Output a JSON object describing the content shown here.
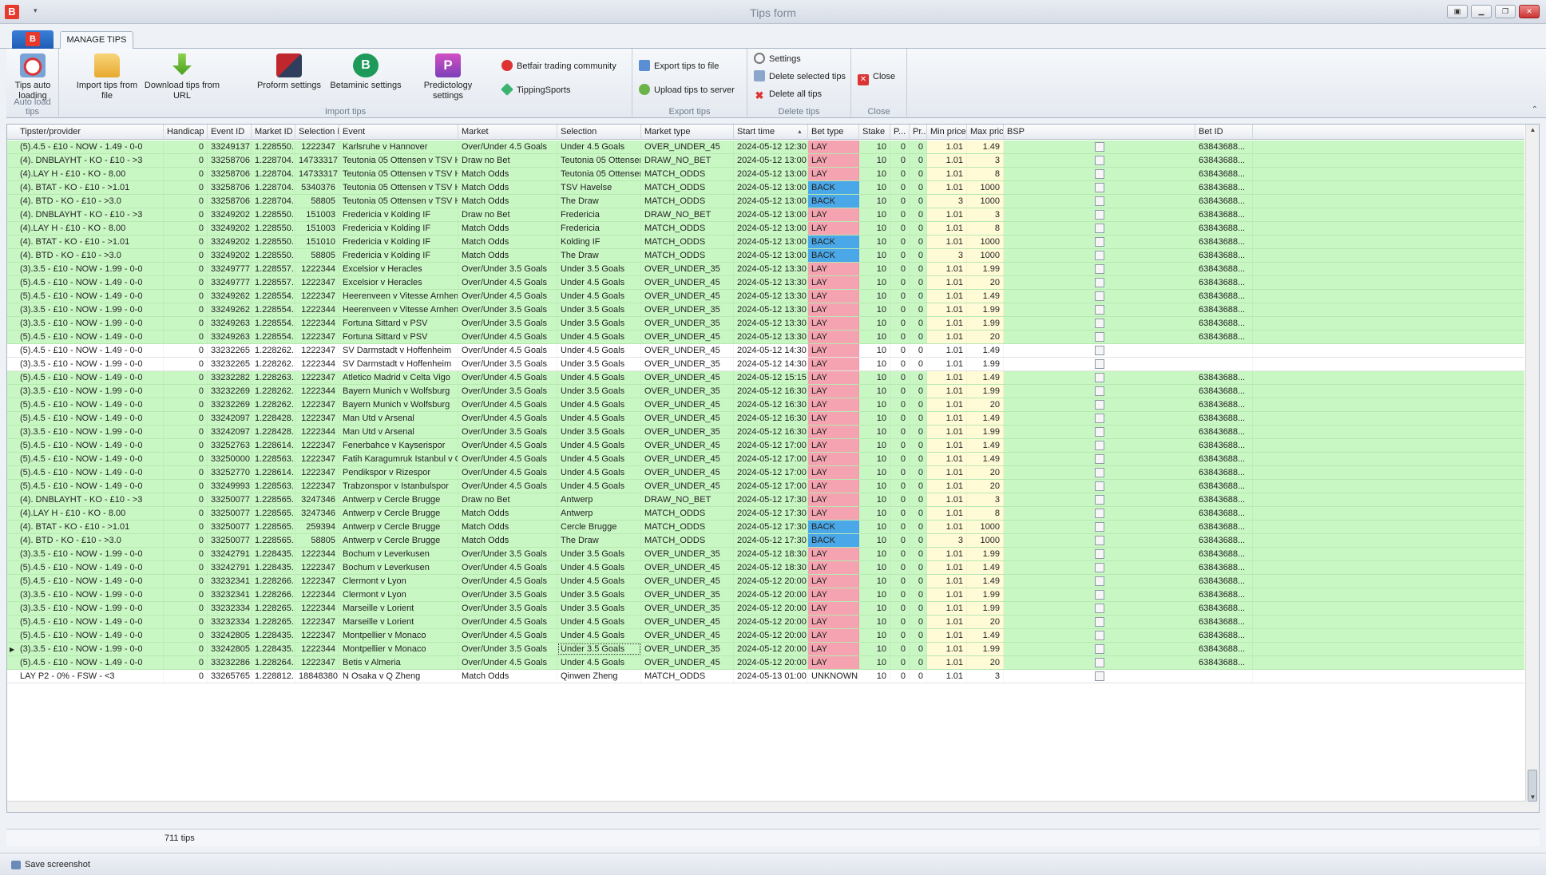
{
  "window": {
    "title": "Tips form",
    "logo": "B"
  },
  "ribbon": {
    "tab": "MANAGE TIPS",
    "groups": [
      {
        "title": "Auto load tips",
        "buttons": [
          {
            "label": "Tips auto loading",
            "icon": "auto-load-icon"
          }
        ]
      },
      {
        "title": "Import tips",
        "buttons": [
          {
            "label": "Import tips from file",
            "icon": "folder-icon"
          },
          {
            "label": "Download tips from URL",
            "icon": "download-icon"
          },
          {
            "label": "Proform settings",
            "icon": "proform-icon"
          },
          {
            "label": "Betaminic settings",
            "icon": "betaminic-icon"
          },
          {
            "label": "Predictology settings",
            "icon": "predictology-icon"
          },
          {
            "label": "Betfair trading community",
            "icon": "btc-icon"
          },
          {
            "label": "TippingSports",
            "icon": "tippingsports-icon"
          }
        ]
      },
      {
        "title": "Export tips",
        "buttons": [
          {
            "label": "Export tips to file",
            "icon": "export-icon"
          },
          {
            "label": "Upload tips to server",
            "icon": "upload-icon"
          }
        ]
      },
      {
        "title": "Delete tips",
        "buttons": [
          {
            "label": "Settings",
            "icon": "gear-icon"
          },
          {
            "label": "Delete selected tips",
            "icon": "delete-selected-icon"
          },
          {
            "label": "Delete all tips",
            "icon": "delete-all-icon"
          }
        ]
      },
      {
        "title": "Close",
        "buttons": [
          {
            "label": "Close",
            "icon": "close-icon"
          }
        ]
      }
    ]
  },
  "grid": {
    "columns": [
      "Tipster/provider",
      "Handicap",
      "Event ID",
      "Market ID",
      "Selection ID",
      "Event",
      "Market",
      "Selection",
      "Market type",
      "Start time",
      "Bet type",
      "Stake",
      "P...",
      "Pr...",
      "Min price",
      "Max price",
      "BSP",
      "Bet ID"
    ],
    "rows": [
      [
        "(5).4.5 - £10 - NOW - 1.49 - 0-0",
        "0",
        "33249137",
        "1.228550...",
        "1222347",
        "Karlsruhe v Hannover",
        "Over/Under 4.5 Goals",
        "Under 4.5 Goals",
        "OVER_UNDER_45",
        "2024-05-12 12:30",
        "LAY",
        "10",
        "0",
        "0",
        "1.01",
        "1.49",
        "",
        "63843688..."
      ],
      [
        "(4). DNBLAYHT - KO - £10 - >3",
        "0",
        "33258706",
        "1.228704...",
        "14733317",
        "Teutonia 05 Ottensen v TSV Havel...",
        "Draw no Bet",
        "Teutonia 05 Ottensen",
        "DRAW_NO_BET",
        "2024-05-12 13:00",
        "LAY",
        "10",
        "0",
        "0",
        "1.01",
        "3",
        "",
        "63843688..."
      ],
      [
        "(4).LAY H - £10 - KO - 8.00",
        "0",
        "33258706",
        "1.228704...",
        "14733317",
        "Teutonia 05 Ottensen v TSV Havel...",
        "Match Odds",
        "Teutonia 05 Ottensen",
        "MATCH_ODDS",
        "2024-05-12 13:00",
        "LAY",
        "10",
        "0",
        "0",
        "1.01",
        "8",
        "",
        "63843688..."
      ],
      [
        "(4). BTAT - KO - £10 - >1.01",
        "0",
        "33258706",
        "1.228704...",
        "5340376",
        "Teutonia 05 Ottensen v TSV Havel...",
        "Match Odds",
        "TSV Havelse",
        "MATCH_ODDS",
        "2024-05-12 13:00",
        "BACK",
        "10",
        "0",
        "0",
        "1.01",
        "1000",
        "",
        "63843688..."
      ],
      [
        "(4). BTD - KO - £10 - >3.0",
        "0",
        "33258706",
        "1.228704...",
        "58805",
        "Teutonia 05 Ottensen v TSV Havel...",
        "Match Odds",
        "The Draw",
        "MATCH_ODDS",
        "2024-05-12 13:00",
        "BACK",
        "10",
        "0",
        "0",
        "3",
        "1000",
        "",
        "63843688..."
      ],
      [
        "(4). DNBLAYHT - KO - £10 - >3",
        "0",
        "33249202",
        "1.228550...",
        "151003",
        "Fredericia v Kolding IF",
        "Draw no Bet",
        "Fredericia",
        "DRAW_NO_BET",
        "2024-05-12 13:00",
        "LAY",
        "10",
        "0",
        "0",
        "1.01",
        "3",
        "",
        "63843688..."
      ],
      [
        "(4).LAY H - £10 - KO - 8.00",
        "0",
        "33249202",
        "1.228550...",
        "151003",
        "Fredericia v Kolding IF",
        "Match Odds",
        "Fredericia",
        "MATCH_ODDS",
        "2024-05-12 13:00",
        "LAY",
        "10",
        "0",
        "0",
        "1.01",
        "8",
        "",
        "63843688..."
      ],
      [
        "(4). BTAT - KO - £10 - >1.01",
        "0",
        "33249202",
        "1.228550...",
        "151010",
        "Fredericia v Kolding IF",
        "Match Odds",
        "Kolding IF",
        "MATCH_ODDS",
        "2024-05-12 13:00",
        "BACK",
        "10",
        "0",
        "0",
        "1.01",
        "1000",
        "",
        "63843688..."
      ],
      [
        "(4). BTD - KO - £10 - >3.0",
        "0",
        "33249202",
        "1.228550...",
        "58805",
        "Fredericia v Kolding IF",
        "Match Odds",
        "The Draw",
        "MATCH_ODDS",
        "2024-05-12 13:00",
        "BACK",
        "10",
        "0",
        "0",
        "3",
        "1000",
        "",
        "63843688..."
      ],
      [
        "(3).3.5 - £10 - NOW - 1.99 - 0-0",
        "0",
        "33249777",
        "1.228557...",
        "1222344",
        "Excelsior v Heracles",
        "Over/Under 3.5 Goals",
        "Under 3.5 Goals",
        "OVER_UNDER_35",
        "2024-05-12 13:30",
        "LAY",
        "10",
        "0",
        "0",
        "1.01",
        "1.99",
        "",
        "63843688..."
      ],
      [
        "(5).4.5 - £10 - NOW - 1.49 - 0-0",
        "0",
        "33249777",
        "1.228557...",
        "1222347",
        "Excelsior v Heracles",
        "Over/Under 4.5 Goals",
        "Under 4.5 Goals",
        "OVER_UNDER_45",
        "2024-05-12 13:30",
        "LAY",
        "10",
        "0",
        "0",
        "1.01",
        "20",
        "",
        "63843688..."
      ],
      [
        "(5).4.5 - £10 - NOW - 1.49 - 0-0",
        "0",
        "33249262",
        "1.228554...",
        "1222347",
        "Heerenveen v Vitesse Arnhem",
        "Over/Under 4.5 Goals",
        "Under 4.5 Goals",
        "OVER_UNDER_45",
        "2024-05-12 13:30",
        "LAY",
        "10",
        "0",
        "0",
        "1.01",
        "1.49",
        "",
        "63843688..."
      ],
      [
        "(3).3.5 - £10 - NOW - 1.99 - 0-0",
        "0",
        "33249262",
        "1.228554...",
        "1222344",
        "Heerenveen v Vitesse Arnhem",
        "Over/Under 3.5 Goals",
        "Under 3.5 Goals",
        "OVER_UNDER_35",
        "2024-05-12 13:30",
        "LAY",
        "10",
        "0",
        "0",
        "1.01",
        "1.99",
        "",
        "63843688..."
      ],
      [
        "(3).3.5 - £10 - NOW - 1.99 - 0-0",
        "0",
        "33249263",
        "1.228554...",
        "1222344",
        "Fortuna Sittard v PSV",
        "Over/Under 3.5 Goals",
        "Under 3.5 Goals",
        "OVER_UNDER_35",
        "2024-05-12 13:30",
        "LAY",
        "10",
        "0",
        "0",
        "1.01",
        "1.99",
        "",
        "63843688..."
      ],
      [
        "(5).4.5 - £10 - NOW - 1.49 - 0-0",
        "0",
        "33249263",
        "1.228554...",
        "1222347",
        "Fortuna Sittard v PSV",
        "Over/Under 4.5 Goals",
        "Under 4.5 Goals",
        "OVER_UNDER_45",
        "2024-05-12 13:30",
        "LAY",
        "10",
        "0",
        "0",
        "1.01",
        "20",
        "",
        "63843688..."
      ],
      [
        "(5).4.5 - £10 - NOW - 1.49 - 0-0",
        "0",
        "33232265",
        "1.228262...",
        "1222347",
        "SV Darmstadt v Hoffenheim",
        "Over/Under 4.5 Goals",
        "Under 4.5 Goals",
        "OVER_UNDER_45",
        "2024-05-12 14:30",
        "LAY",
        "10",
        "0",
        "0",
        "1.01",
        "1.49",
        "",
        ""
      ],
      [
        "(3).3.5 - £10 - NOW - 1.99 - 0-0",
        "0",
        "33232265",
        "1.228262...",
        "1222344",
        "SV Darmstadt v Hoffenheim",
        "Over/Under 3.5 Goals",
        "Under 3.5 Goals",
        "OVER_UNDER_35",
        "2024-05-12 14:30",
        "LAY",
        "10",
        "0",
        "0",
        "1.01",
        "1.99",
        "",
        ""
      ],
      [
        "(5).4.5 - £10 - NOW - 1.49 - 0-0",
        "0",
        "33232282",
        "1.228263...",
        "1222347",
        "Atletico Madrid v Celta Vigo",
        "Over/Under 4.5 Goals",
        "Under 4.5 Goals",
        "OVER_UNDER_45",
        "2024-05-12 15:15",
        "LAY",
        "10",
        "0",
        "0",
        "1.01",
        "1.49",
        "",
        "63843688..."
      ],
      [
        "(3).3.5 - £10 - NOW - 1.99 - 0-0",
        "0",
        "33232269",
        "1.228262...",
        "1222344",
        "Bayern Munich v Wolfsburg",
        "Over/Under 3.5 Goals",
        "Under 3.5 Goals",
        "OVER_UNDER_35",
        "2024-05-12 16:30",
        "LAY",
        "10",
        "0",
        "0",
        "1.01",
        "1.99",
        "",
        "63843688..."
      ],
      [
        "(5).4.5 - £10 - NOW - 1.49 - 0-0",
        "0",
        "33232269",
        "1.228262...",
        "1222347",
        "Bayern Munich v Wolfsburg",
        "Over/Under 4.5 Goals",
        "Under 4.5 Goals",
        "OVER_UNDER_45",
        "2024-05-12 16:30",
        "LAY",
        "10",
        "0",
        "0",
        "1.01",
        "20",
        "",
        "63843688..."
      ],
      [
        "(5).4.5 - £10 - NOW - 1.49 - 0-0",
        "0",
        "33242097",
        "1.228428...",
        "1222347",
        "Man Utd v Arsenal",
        "Over/Under 4.5 Goals",
        "Under 4.5 Goals",
        "OVER_UNDER_45",
        "2024-05-12 16:30",
        "LAY",
        "10",
        "0",
        "0",
        "1.01",
        "1.49",
        "",
        "63843688..."
      ],
      [
        "(3).3.5 - £10 - NOW - 1.99 - 0-0",
        "0",
        "33242097",
        "1.228428...",
        "1222344",
        "Man Utd v Arsenal",
        "Over/Under 3.5 Goals",
        "Under 3.5 Goals",
        "OVER_UNDER_35",
        "2024-05-12 16:30",
        "LAY",
        "10",
        "0",
        "0",
        "1.01",
        "1.99",
        "",
        "63843688..."
      ],
      [
        "(5).4.5 - £10 - NOW - 1.49 - 0-0",
        "0",
        "33252763",
        "1.228614...",
        "1222347",
        "Fenerbahce v Kayserispor",
        "Over/Under 4.5 Goals",
        "Under 4.5 Goals",
        "OVER_UNDER_45",
        "2024-05-12 17:00",
        "LAY",
        "10",
        "0",
        "0",
        "1.01",
        "1.49",
        "",
        "63843688..."
      ],
      [
        "(5).4.5 - £10 - NOW - 1.49 - 0-0",
        "0",
        "33250000",
        "1.228563...",
        "1222347",
        "Fatih Karagumruk Istanbul v Galat...",
        "Over/Under 4.5 Goals",
        "Under 4.5 Goals",
        "OVER_UNDER_45",
        "2024-05-12 17:00",
        "LAY",
        "10",
        "0",
        "0",
        "1.01",
        "1.49",
        "",
        "63843688..."
      ],
      [
        "(5).4.5 - £10 - NOW - 1.49 - 0-0",
        "0",
        "33252770",
        "1.228614...",
        "1222347",
        "Pendikspor v Rizespor",
        "Over/Under 4.5 Goals",
        "Under 4.5 Goals",
        "OVER_UNDER_45",
        "2024-05-12 17:00",
        "LAY",
        "10",
        "0",
        "0",
        "1.01",
        "20",
        "",
        "63843688..."
      ],
      [
        "(5).4.5 - £10 - NOW - 1.49 - 0-0",
        "0",
        "33249993",
        "1.228563...",
        "1222347",
        "Trabzonspor v Istanbulspor",
        "Over/Under 4.5 Goals",
        "Under 4.5 Goals",
        "OVER_UNDER_45",
        "2024-05-12 17:00",
        "LAY",
        "10",
        "0",
        "0",
        "1.01",
        "20",
        "",
        "63843688..."
      ],
      [
        "(4). DNBLAYHT - KO - £10 - >3",
        "0",
        "33250077",
        "1.228565...",
        "3247346",
        "Antwerp v Cercle Brugge",
        "Draw no Bet",
        "Antwerp",
        "DRAW_NO_BET",
        "2024-05-12 17:30",
        "LAY",
        "10",
        "0",
        "0",
        "1.01",
        "3",
        "",
        "63843688..."
      ],
      [
        "(4).LAY H - £10 - KO - 8.00",
        "0",
        "33250077",
        "1.228565...",
        "3247346",
        "Antwerp v Cercle Brugge",
        "Match Odds",
        "Antwerp",
        "MATCH_ODDS",
        "2024-05-12 17:30",
        "LAY",
        "10",
        "0",
        "0",
        "1.01",
        "8",
        "",
        "63843688..."
      ],
      [
        "(4). BTAT - KO - £10 - >1.01",
        "0",
        "33250077",
        "1.228565...",
        "259394",
        "Antwerp v Cercle Brugge",
        "Match Odds",
        "Cercle Brugge",
        "MATCH_ODDS",
        "2024-05-12 17:30",
        "BACK",
        "10",
        "0",
        "0",
        "1.01",
        "1000",
        "",
        "63843688..."
      ],
      [
        "(4). BTD - KO - £10 - >3.0",
        "0",
        "33250077",
        "1.228565...",
        "58805",
        "Antwerp v Cercle Brugge",
        "Match Odds",
        "The Draw",
        "MATCH_ODDS",
        "2024-05-12 17:30",
        "BACK",
        "10",
        "0",
        "0",
        "3",
        "1000",
        "",
        "63843688..."
      ],
      [
        "(3).3.5 - £10 - NOW - 1.99 - 0-0",
        "0",
        "33242791",
        "1.228435...",
        "1222344",
        "Bochum v Leverkusen",
        "Over/Under 3.5 Goals",
        "Under 3.5 Goals",
        "OVER_UNDER_35",
        "2024-05-12 18:30",
        "LAY",
        "10",
        "0",
        "0",
        "1.01",
        "1.99",
        "",
        "63843688..."
      ],
      [
        "(5).4.5 - £10 - NOW - 1.49 - 0-0",
        "0",
        "33242791",
        "1.228435...",
        "1222347",
        "Bochum v Leverkusen",
        "Over/Under 4.5 Goals",
        "Under 4.5 Goals",
        "OVER_UNDER_45",
        "2024-05-12 18:30",
        "LAY",
        "10",
        "0",
        "0",
        "1.01",
        "1.49",
        "",
        "63843688..."
      ],
      [
        "(5).4.5 - £10 - NOW - 1.49 - 0-0",
        "0",
        "33232341",
        "1.228266...",
        "1222347",
        "Clermont v Lyon",
        "Over/Under 4.5 Goals",
        "Under 4.5 Goals",
        "OVER_UNDER_45",
        "2024-05-12 20:00",
        "LAY",
        "10",
        "0",
        "0",
        "1.01",
        "1.49",
        "",
        "63843688..."
      ],
      [
        "(3).3.5 - £10 - NOW - 1.99 - 0-0",
        "0",
        "33232341",
        "1.228266...",
        "1222344",
        "Clermont v Lyon",
        "Over/Under 3.5 Goals",
        "Under 3.5 Goals",
        "OVER_UNDER_35",
        "2024-05-12 20:00",
        "LAY",
        "10",
        "0",
        "0",
        "1.01",
        "1.99",
        "",
        "63843688..."
      ],
      [
        "(3).3.5 - £10 - NOW - 1.99 - 0-0",
        "0",
        "33232334",
        "1.228265...",
        "1222344",
        "Marseille v Lorient",
        "Over/Under 3.5 Goals",
        "Under 3.5 Goals",
        "OVER_UNDER_35",
        "2024-05-12 20:00",
        "LAY",
        "10",
        "0",
        "0",
        "1.01",
        "1.99",
        "",
        "63843688..."
      ],
      [
        "(5).4.5 - £10 - NOW - 1.49 - 0-0",
        "0",
        "33232334",
        "1.228265...",
        "1222347",
        "Marseille v Lorient",
        "Over/Under 4.5 Goals",
        "Under 4.5 Goals",
        "OVER_UNDER_45",
        "2024-05-12 20:00",
        "LAY",
        "10",
        "0",
        "0",
        "1.01",
        "20",
        "",
        "63843688..."
      ],
      [
        "(5).4.5 - £10 - NOW - 1.49 - 0-0",
        "0",
        "33242805",
        "1.228435...",
        "1222347",
        "Montpellier v Monaco",
        "Over/Under 4.5 Goals",
        "Under 4.5 Goals",
        "OVER_UNDER_45",
        "2024-05-12 20:00",
        "LAY",
        "10",
        "0",
        "0",
        "1.01",
        "1.49",
        "",
        "63843688..."
      ],
      [
        "(3).3.5 - £10 - NOW - 1.99 - 0-0",
        "0",
        "33242805",
        "1.228435...",
        "1222344",
        "Montpellier v Monaco",
        "Over/Under 3.5 Goals",
        "Under 3.5 Goals",
        "OVER_UNDER_35",
        "2024-05-12 20:00",
        "LAY",
        "10",
        "0",
        "0",
        "1.01",
        "1.99",
        "",
        "63843688..."
      ],
      [
        "(5).4.5 - £10 - NOW - 1.49 - 0-0",
        "0",
        "33232286",
        "1.228264...",
        "1222347",
        "Betis v Almeria",
        "Over/Under 4.5 Goals",
        "Under 4.5 Goals",
        "OVER_UNDER_45",
        "2024-05-12 20:00",
        "LAY",
        "10",
        "0",
        "0",
        "1.01",
        "20",
        "",
        "63843688..."
      ],
      [
        "LAY P2 - 0% - FSW - <3",
        "0",
        "33265765",
        "1.228812...",
        "18848380",
        "N Osaka v Q Zheng",
        "Match Odds",
        "Qinwen Zheng",
        "MATCH_ODDS",
        "2024-05-13 01:00",
        "UNKNOWN",
        "10",
        "0",
        "0",
        "1.01",
        "3",
        "",
        ""
      ]
    ]
  },
  "footer": {
    "tip_count": "711 tips"
  },
  "status": {
    "save_screenshot": "Save screenshot"
  },
  "colors": {
    "row_green": "#c9f7c4",
    "lay": "#f5a3b0",
    "back": "#4aa8e8",
    "price_highlight": "#fffbd6"
  }
}
